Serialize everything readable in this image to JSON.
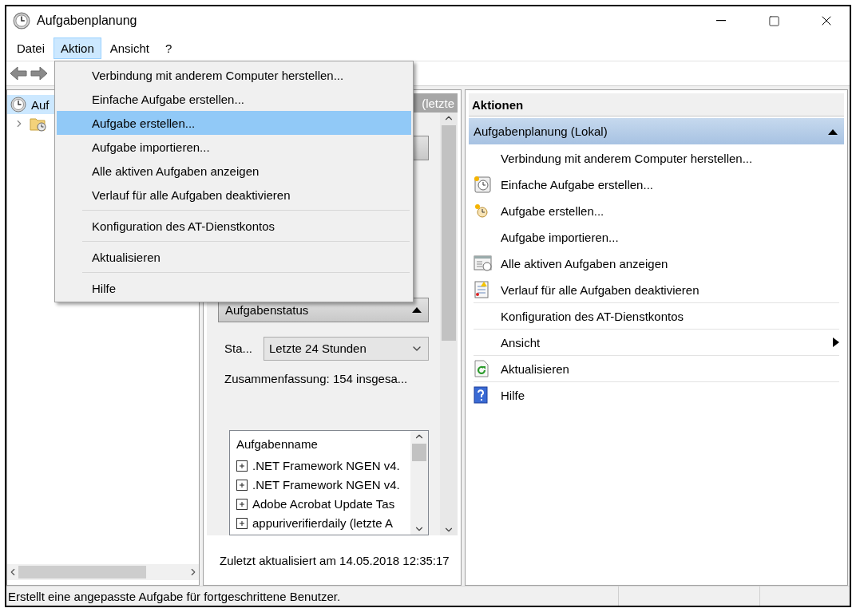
{
  "window": {
    "title": "Aufgabenplanung"
  },
  "menu_bar": [
    {
      "label": "Datei",
      "selected": false
    },
    {
      "label": "Aktion",
      "selected": true
    },
    {
      "label": "Ansicht",
      "selected": false
    },
    {
      "label": "?",
      "selected": false
    }
  ],
  "action_menu": [
    {
      "label": "Verbindung mit anderem Computer herstellen...",
      "selected": false,
      "separator_before": false
    },
    {
      "label": "Einfache Aufgabe erstellen...",
      "selected": false,
      "separator_before": false
    },
    {
      "label": "Aufgabe erstellen...",
      "selected": true,
      "separator_before": false
    },
    {
      "label": "Aufgabe importieren...",
      "selected": false,
      "separator_before": false
    },
    {
      "label": "Alle aktiven Aufgaben anzeigen",
      "selected": false,
      "separator_before": false
    },
    {
      "label": "Verlauf für alle Aufgaben deaktivieren",
      "selected": false,
      "separator_before": false
    },
    {
      "label": "Konfiguration des AT-Dienstkontos",
      "selected": false,
      "separator_before": true
    },
    {
      "label": "Aktualisieren",
      "selected": false,
      "separator_before": true
    },
    {
      "label": "Hilfe",
      "selected": false,
      "separator_before": true
    }
  ],
  "tree": {
    "items": [
      {
        "label": "Auf",
        "selected": true,
        "children": [
          {
            "expanded": false,
            "selected": false
          }
        ]
      }
    ]
  },
  "middle_pane": {
    "header": "(letzte",
    "status_section": {
      "title": "Aufgabenstatus",
      "expanded": true,
      "filter_label": "Sta...",
      "filter_value": "Letzte 24 Stunden",
      "summary": "Zusammenfassung: 154 insgesa...",
      "table": {
        "columns": [
          "Aufgabenname"
        ],
        "rows": [
          {
            "name": ".NET Framework NGEN v4.",
            "expanded": false
          },
          {
            "name": ".NET Framework NGEN v4.",
            "expanded": false
          },
          {
            "name": "Adobe Acrobat Update Tas",
            "expanded": false
          },
          {
            "name": "appuriverifierdaily (letzte A",
            "expanded": false
          }
        ]
      }
    },
    "footer": "Zuletzt aktualisiert am 14.05.2018 12:35:17"
  },
  "actions_pane": {
    "title": "Aktionen",
    "group": {
      "label": "Aufgabenplanung (Lokal)",
      "expanded": true
    },
    "items": [
      {
        "label": "Verbindung mit anderem Computer herstellen...",
        "kind": "plain",
        "separator_before": false,
        "submenu": false
      },
      {
        "label": "Einfache Aufgabe erstellen...",
        "kind": "clockcard",
        "separator_before": false,
        "submenu": false
      },
      {
        "label": "Aufgabe erstellen...",
        "kind": "clockstar",
        "separator_before": false,
        "submenu": false
      },
      {
        "label": "Aufgabe importieren...",
        "kind": "plain",
        "separator_before": false,
        "submenu": false
      },
      {
        "label": "Alle aktiven Aufgaben anzeigen",
        "kind": "window",
        "separator_before": false,
        "submenu": false
      },
      {
        "label": "Verlauf für alle Aufgaben deaktivieren",
        "kind": "log",
        "separator_before": false,
        "submenu": false
      },
      {
        "label": "Konfiguration des AT-Dienstkontos",
        "kind": "plain",
        "separator_before": true,
        "submenu": false
      },
      {
        "label": "Ansicht",
        "kind": "plain",
        "separator_before": true,
        "submenu": true
      },
      {
        "label": "Aktualisieren",
        "kind": "refresh",
        "separator_before": true,
        "submenu": false
      },
      {
        "label": "Hilfe",
        "kind": "help",
        "separator_before": true,
        "submenu": false
      }
    ]
  },
  "status_bar": {
    "text": "Erstellt eine angepasste Aufgabe für fortgeschrittene Benutzer."
  }
}
